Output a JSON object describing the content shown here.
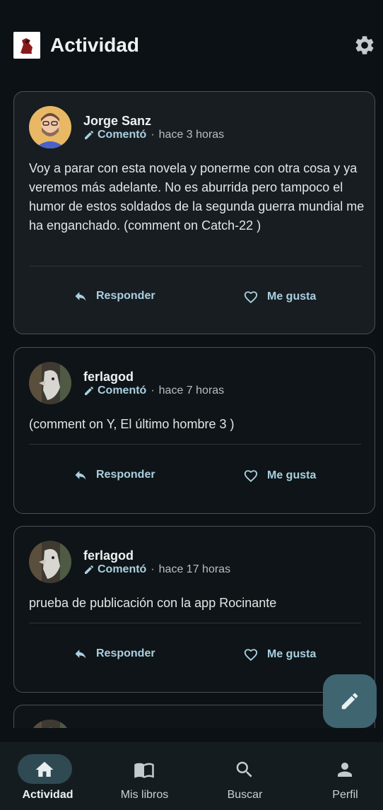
{
  "header": {
    "title": "Actividad"
  },
  "posts": [
    {
      "user": "Jorge Sanz",
      "action": "Comentó",
      "sep": "·",
      "time": "hace 3 horas",
      "text": "Voy a parar con esta novela y ponerme con otra cosa y ya veremos más adelante. No es aburrida pero tampoco el humor de estos soldados de la segunda guerra mundial me ha enganchado. (comment on Catch-22 )",
      "reply": "Responder",
      "like": "Me gusta"
    },
    {
      "user": "ferlagod",
      "action": "Comentó",
      "sep": "·",
      "time": "hace 7 horas",
      "text": "(comment on Y, El último hombre 3 )",
      "reply": "Responder",
      "like": "Me gusta"
    },
    {
      "user": "ferlagod",
      "action": "Comentó",
      "sep": "·",
      "time": "hace 17 horas",
      "text": "prueba de publicación con la app Rocinante",
      "reply": "Responder",
      "like": "Me gusta"
    }
  ],
  "bottom_nav": {
    "items": [
      {
        "label": "Actividad",
        "icon": "home-icon",
        "active": true
      },
      {
        "label": "Mis libros",
        "icon": "book-icon",
        "active": false
      },
      {
        "label": "Buscar",
        "icon": "search-icon",
        "active": false
      },
      {
        "label": "Perfil",
        "icon": "person-icon",
        "active": false
      }
    ]
  },
  "colors": {
    "background": "#0b1114",
    "accent": "#a9cfe0",
    "fab": "#3e6570",
    "nav_pill": "#2f4a52"
  }
}
